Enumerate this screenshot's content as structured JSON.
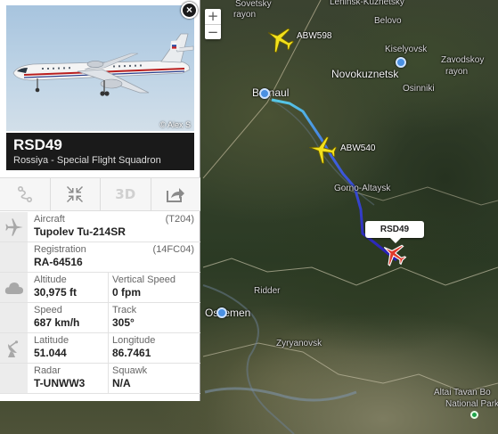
{
  "map": {
    "zoom_in": "+",
    "zoom_out": "−",
    "labels": {
      "lenin": "Leninsk-Kuznetsky",
      "sovetsky": "Sovetsky",
      "rayon1": "rayon",
      "belovo": "Belovo",
      "kiselyovsk": "Kiselyovsk",
      "zavodskoy": "Zavodskoy",
      "rayon2": "rayon",
      "novokuznetsk": "Novokuznetsk",
      "osinniki": "Osinniki",
      "barnaul": "Barnaul",
      "gorno": "Gorno-Altaysk",
      "ridder": "Ridder",
      "oskemen": "Oskemen",
      "zyryanovsk": "Zyryanovsk",
      "tavan": "Altai Tavan Bo",
      "np": "National Park"
    },
    "flights": [
      {
        "label": "ABW598"
      },
      {
        "label": "ABW540"
      }
    ],
    "selected_callout": "RSD49",
    "colors": {
      "track_start": "#56c8e6",
      "track_end": "#2a1db5",
      "selected_plane": "#e0392b",
      "other_plane": "#f2e11b"
    }
  },
  "panel": {
    "close_label": "×",
    "photo_credit": "© Alex S",
    "callsign": "RSD49",
    "airline": "Rossiya - Special Flight Squadron",
    "toolbar": {
      "route_icon": "route-icon",
      "expand_icon": "shrink-icon",
      "three_d_label": "3D",
      "share_icon": "share-icon"
    },
    "aircraft": {
      "label": "Aircraft",
      "code": "(T204)",
      "value": "Tupolev Tu-214SR"
    },
    "registration": {
      "label": "Registration",
      "code": "(14FC04)",
      "value": "RA-64516"
    },
    "altitude": {
      "label": "Altitude",
      "value": "30,975 ft"
    },
    "vspeed": {
      "label": "Vertical Speed",
      "value": "0 fpm"
    },
    "speed": {
      "label": "Speed",
      "value": "687 km/h"
    },
    "track": {
      "label": "Track",
      "value": "305°"
    },
    "latitude": {
      "label": "Latitude",
      "value": "51.044"
    },
    "longitude": {
      "label": "Longitude",
      "value": "86.7461"
    },
    "radar": {
      "label": "Radar",
      "value": "T-UNWW3"
    },
    "squawk": {
      "label": "Squawk",
      "value": "N/A"
    }
  }
}
